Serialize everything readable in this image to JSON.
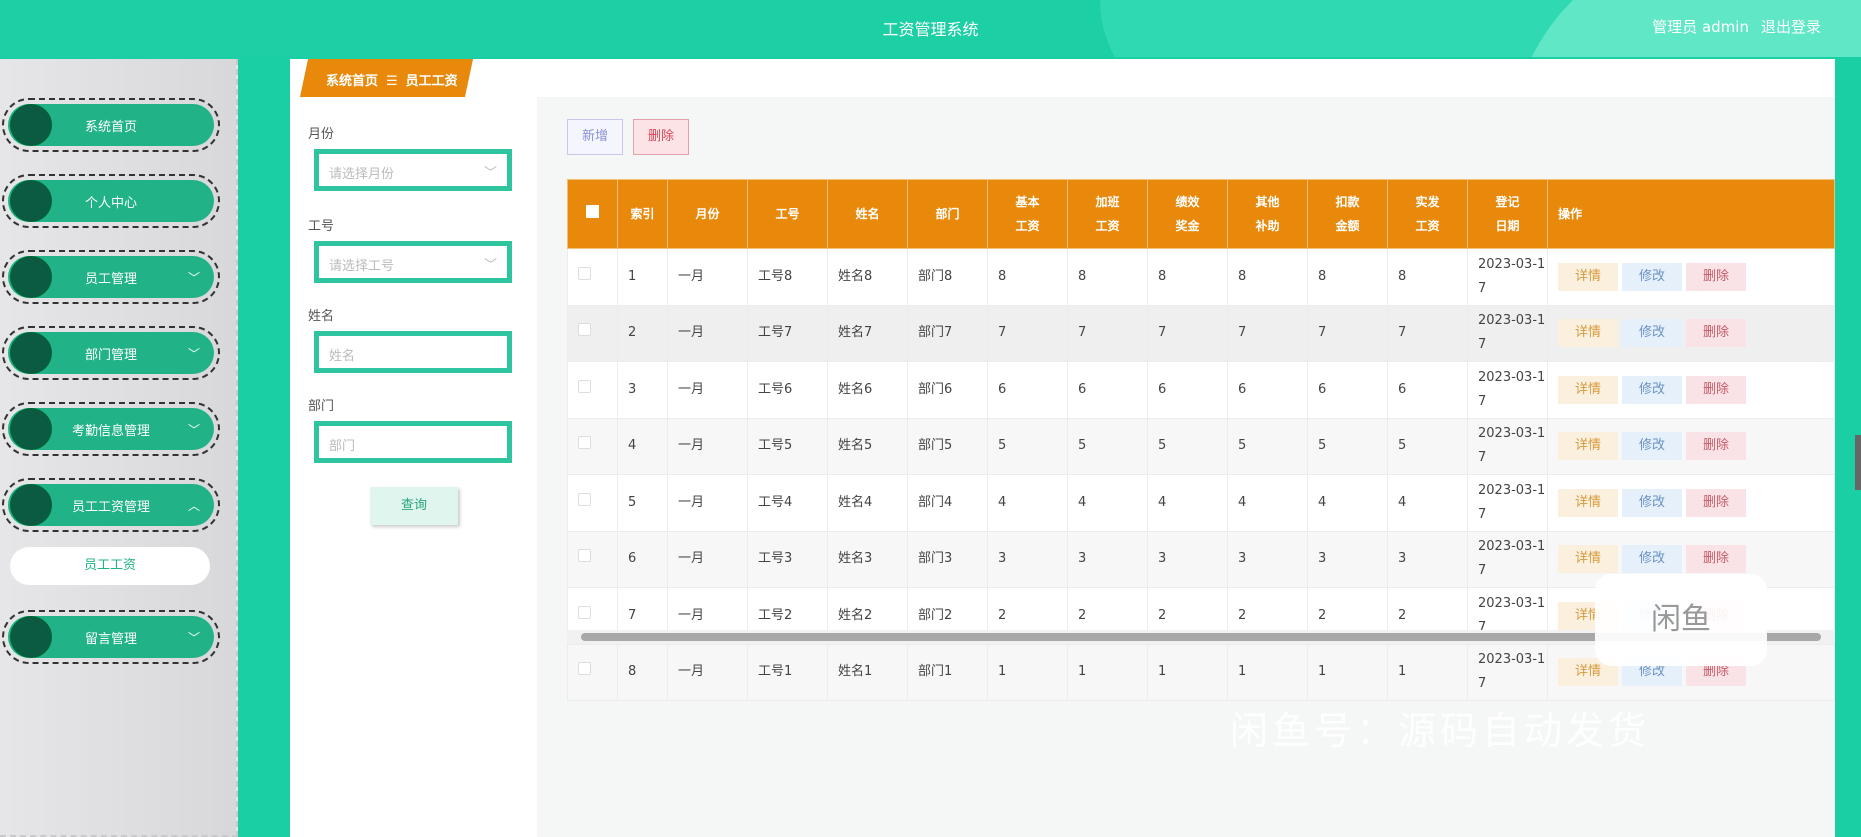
{
  "header": {
    "title": "工资管理系统",
    "user": "管理员 admin",
    "logout": "退出登录"
  },
  "sidebar": {
    "items": [
      {
        "label": "系统首页",
        "chevron": ""
      },
      {
        "label": "个人中心",
        "chevron": ""
      },
      {
        "label": "员工管理",
        "chevron": "﹀"
      },
      {
        "label": "部门管理",
        "chevron": "﹀"
      },
      {
        "label": "考勤信息管理",
        "chevron": "﹀"
      },
      {
        "label": "员工工资管理",
        "chevron": "︿"
      },
      {
        "label": "留言管理",
        "chevron": "﹀"
      }
    ],
    "sub_item": "员工工资"
  },
  "breadcrumb": {
    "home": "系统首页",
    "sep": "☰",
    "current": "员工工资"
  },
  "search": {
    "month_label": "月份",
    "month_placeholder": "请选择月份",
    "id_label": "工号",
    "id_placeholder": "请选择工号",
    "name_label": "姓名",
    "name_placeholder": "姓名",
    "dept_label": "部门",
    "dept_placeholder": "部门",
    "query": "查询"
  },
  "toolbar": {
    "add": "新增",
    "delete": "删除"
  },
  "table": {
    "headers": [
      "索引",
      "月份",
      "工号",
      "姓名",
      "部门",
      "基本工资",
      "加班工资",
      "绩效奖金",
      "其他补助",
      "扣款金额",
      "实发工资",
      "登记日期",
      "操作"
    ],
    "actions": {
      "detail": "详情",
      "edit": "修改",
      "delete": "删除"
    },
    "rows": [
      [
        "1",
        "一月",
        "工号8",
        "姓名8",
        "部门8",
        "8",
        "8",
        "8",
        "8",
        "8",
        "8",
        "2023-03-17"
      ],
      [
        "2",
        "一月",
        "工号7",
        "姓名7",
        "部门7",
        "7",
        "7",
        "7",
        "7",
        "7",
        "7",
        "2023-03-17"
      ],
      [
        "3",
        "一月",
        "工号6",
        "姓名6",
        "部门6",
        "6",
        "6",
        "6",
        "6",
        "6",
        "6",
        "2023-03-17"
      ],
      [
        "4",
        "一月",
        "工号5",
        "姓名5",
        "部门5",
        "5",
        "5",
        "5",
        "5",
        "5",
        "5",
        "2023-03-17"
      ],
      [
        "5",
        "一月",
        "工号4",
        "姓名4",
        "部门4",
        "4",
        "4",
        "4",
        "4",
        "4",
        "4",
        "2023-03-17"
      ],
      [
        "6",
        "一月",
        "工号3",
        "姓名3",
        "部门3",
        "3",
        "3",
        "3",
        "3",
        "3",
        "3",
        "2023-03-17"
      ],
      [
        "7",
        "一月",
        "工号2",
        "姓名2",
        "部门2",
        "2",
        "2",
        "2",
        "2",
        "2",
        "2",
        "2023-03-17"
      ],
      [
        "8",
        "一月",
        "工号1",
        "姓名1",
        "部门1",
        "1",
        "1",
        "1",
        "1",
        "1",
        "1",
        "2023-03-17"
      ]
    ]
  },
  "watermark": {
    "text": "闲鱼号：源码自动发货",
    "logo": "闲鱼"
  }
}
